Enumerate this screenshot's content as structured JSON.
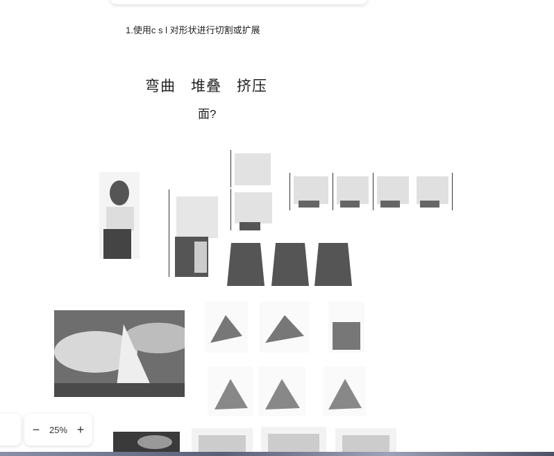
{
  "canvas": {
    "note_text": "1.使用c s l 对形状进行切割或扩展",
    "heading_text": "弯曲　堆叠　挤压",
    "subheading_text": "面?"
  },
  "zoom": {
    "minus_label": "−",
    "value": "25%",
    "plus_label": "+"
  },
  "icons": {
    "zoom_out": "minus-icon",
    "zoom_in": "plus-icon"
  },
  "colors": {
    "background": "#ffffff",
    "text": "#222222",
    "bottom_strip": "#5a5f78"
  }
}
